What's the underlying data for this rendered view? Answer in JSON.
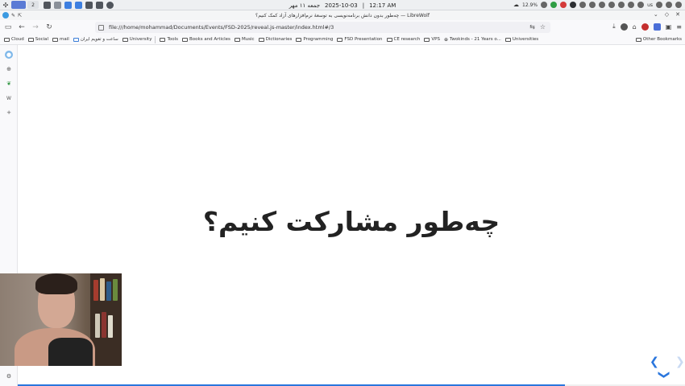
{
  "system_panel": {
    "workspace_active": "",
    "workspace_number": "2",
    "date": "2025-10-03",
    "separator": "|",
    "time": "12:17 AM",
    "date_persian": "جمعه ۱۱ مهر",
    "battery": "12.9%",
    "keyboard_layout": "us"
  },
  "window": {
    "title": "چه‌طور بدون دانش برنامه‌نویسی به توسعهٔ نرم‌افزارهای آزاد کمک کنیم؟ — LibreWolf"
  },
  "navbar": {
    "url": "file:///home/mohammad/Documents/Events/FSD-2025/reveal.js-master/index.html#/3"
  },
  "bookmarks": {
    "items": [
      {
        "label": "Cloud"
      },
      {
        "label": "Social"
      },
      {
        "label": "mail"
      },
      {
        "label": "ساعت و تقویم ایران"
      },
      {
        "label": "University"
      },
      {
        "label": "Tools"
      },
      {
        "label": "Books and Articles"
      },
      {
        "label": "Music"
      },
      {
        "label": "Dictionaries"
      },
      {
        "label": "Programming"
      },
      {
        "label": "FSD Presentation"
      },
      {
        "label": "CE research"
      },
      {
        "label": "VPS"
      },
      {
        "label": "Twokinds - 21 Years o..."
      },
      {
        "label": "Universities"
      }
    ],
    "other": "Other Bookmarks"
  },
  "slide": {
    "title": "چه‌طور مشارکت کنیم؟",
    "progress_fraction": 0.82
  },
  "colors": {
    "accent": "#2a76dd",
    "text": "#222222"
  }
}
